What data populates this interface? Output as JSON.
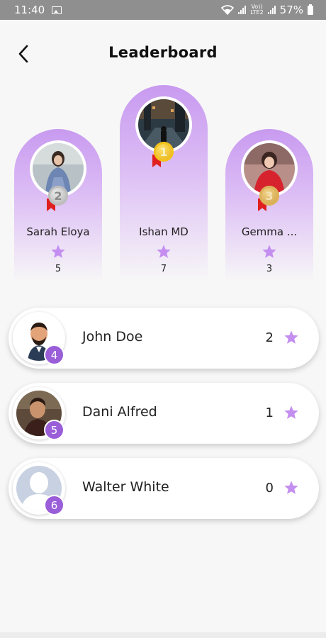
{
  "status_bar": {
    "time": "11:40",
    "carrier_top": "Vo))",
    "carrier_bottom": "LTE2",
    "battery": "57%"
  },
  "header": {
    "title": "Leaderboard"
  },
  "podium": [
    {
      "rank": "2",
      "name": "Sarah Eloya",
      "score": "5",
      "medal": "silver"
    },
    {
      "rank": "1",
      "name": "Ishan MD",
      "score": "7",
      "medal": "gold"
    },
    {
      "rank": "3",
      "name": "Gemma ...",
      "score": "3",
      "medal": "bronze"
    }
  ],
  "list": [
    {
      "rank": "4",
      "name": "John Doe",
      "score": "2"
    },
    {
      "rank": "5",
      "name": "Dani Alfred",
      "score": "1"
    },
    {
      "rank": "6",
      "name": "Walter White",
      "score": "0"
    }
  ],
  "colors": {
    "accent": "#9a5ed8",
    "star": "#c48ef0",
    "podium_top": "#c89af0"
  }
}
